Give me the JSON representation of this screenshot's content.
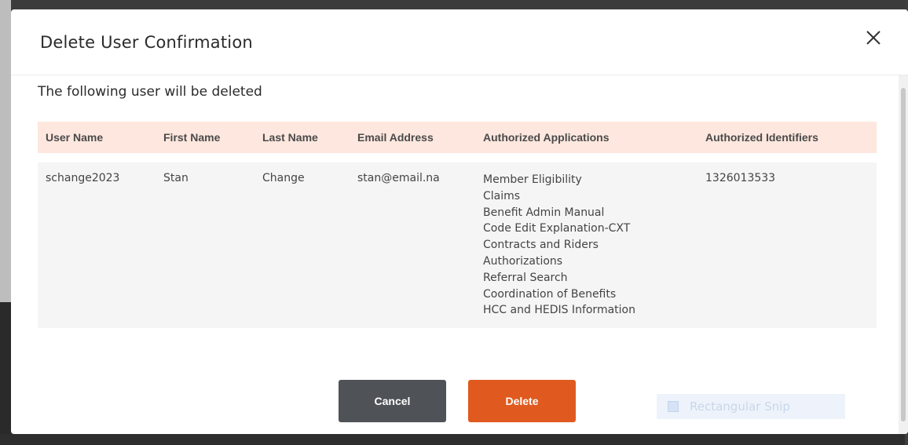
{
  "dialog": {
    "title": "Delete User Confirmation",
    "subtitle": "The following user will be deleted"
  },
  "table": {
    "headers": [
      "User Name",
      "First Name",
      "Last Name",
      "Email Address",
      "Authorized Applications",
      "Authorized Identifiers"
    ],
    "row": {
      "user_name": "schange2023",
      "first_name": "Stan",
      "last_name": "Change",
      "email": "stan@email.na",
      "applications": [
        "Member Eligibility",
        "Claims",
        "Benefit Admin Manual",
        "Code Edit Explanation-CXT",
        "Contracts and Riders",
        "Authorizations",
        "Referral Search",
        "Coordination of Benefits",
        "HCC and HEDIS Information"
      ],
      "identifiers": "1326013533"
    }
  },
  "buttons": {
    "cancel": "Cancel",
    "delete": "Delete"
  },
  "overlay": {
    "snip_label": "Rectangular Snip"
  },
  "colors": {
    "header_bg": "#fde7de",
    "delete_btn": "#e05a1f",
    "cancel_btn": "#4f5256"
  },
  "icons": {
    "close": "close-icon"
  }
}
